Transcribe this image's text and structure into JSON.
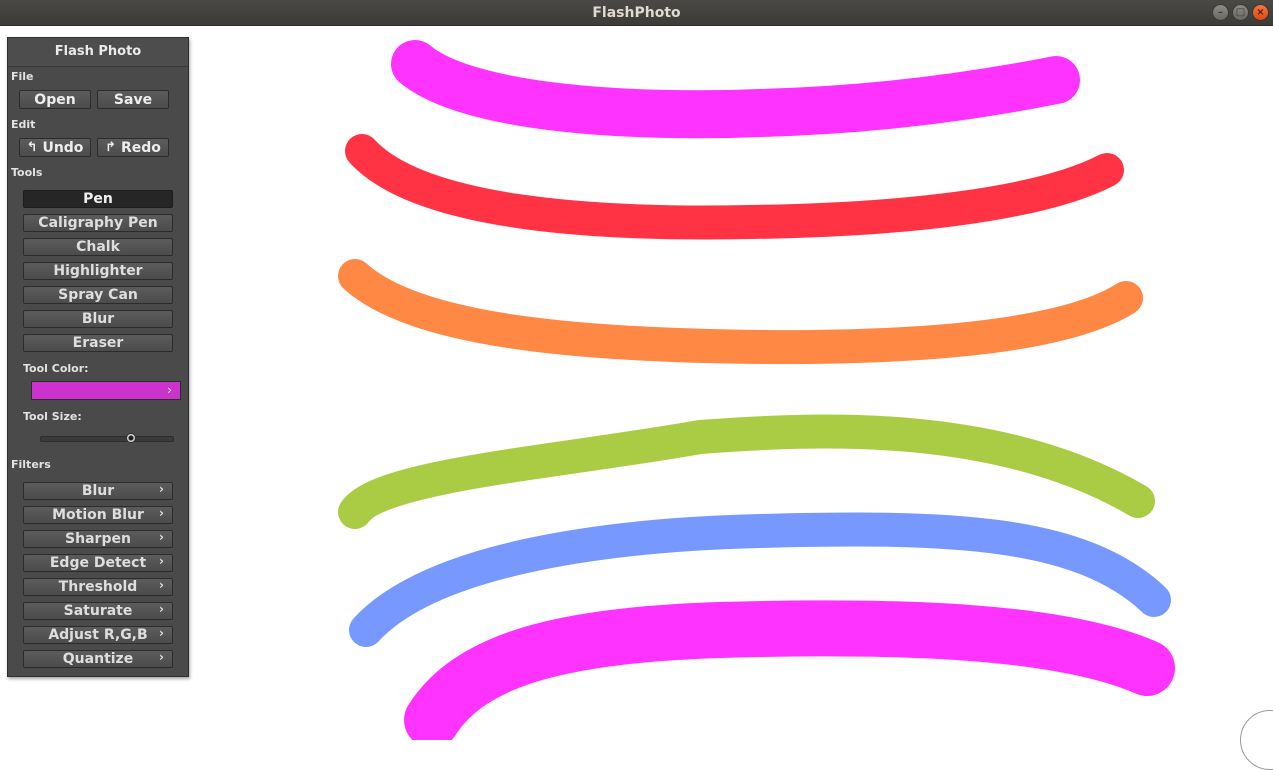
{
  "window": {
    "title": "FlashPhoto",
    "controls": {
      "minimize": "–",
      "maximize": "□",
      "close": "×"
    }
  },
  "panel": {
    "title": "Flash Photo",
    "file": {
      "label": "File",
      "open": "Open",
      "save": "Save"
    },
    "edit": {
      "label": "Edit",
      "undo": "Undo",
      "redo": "Redo"
    },
    "tools": {
      "label": "Tools",
      "items": [
        "Pen",
        "Caligraphy Pen",
        "Chalk",
        "Highlighter",
        "Spray Can",
        "Blur",
        "Eraser"
      ],
      "active": "Pen"
    },
    "tool_color": {
      "label": "Tool Color:",
      "value": "#cc33cc"
    },
    "tool_size": {
      "label": "Tool Size:",
      "value": 0.68
    },
    "filters": {
      "label": "Filters",
      "items": [
        "Blur",
        "Motion Blur",
        "Sharpen",
        "Edge Detect",
        "Threshold",
        "Saturate",
        "Adjust R,G,B",
        "Quantize"
      ]
    }
  },
  "canvas": {
    "strokes": [
      {
        "color": "#ff33ff"
      },
      {
        "color": "#ff3344"
      },
      {
        "color": "#ff8844"
      },
      {
        "color": "#aacc44"
      },
      {
        "color": "#7799ff"
      },
      {
        "color": "#ff33ff"
      }
    ]
  }
}
